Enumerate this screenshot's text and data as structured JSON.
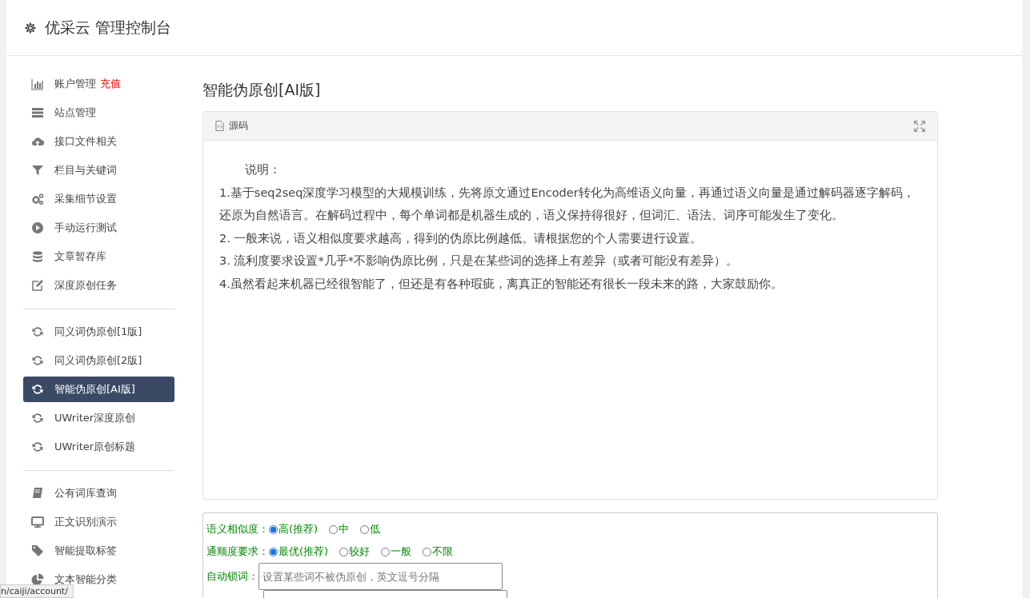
{
  "header": {
    "title": "优采云 管理控制台"
  },
  "sidebar": {
    "groups": [
      {
        "items": [
          {
            "label": "账户管理",
            "extra": "充值",
            "selected": false
          },
          {
            "label": "站点管理",
            "selected": false
          },
          {
            "label": "接口文件相关",
            "selected": false
          },
          {
            "label": "栏目与关键词",
            "selected": false
          },
          {
            "label": "采集细节设置",
            "selected": false
          },
          {
            "label": "手动运行测试",
            "selected": false
          },
          {
            "label": "文章暂存库",
            "selected": false
          },
          {
            "label": "深度原创任务",
            "selected": false
          }
        ]
      },
      {
        "items": [
          {
            "label": "同义词伪原创[1版]",
            "selected": false
          },
          {
            "label": "同义词伪原创[2版]",
            "selected": false
          },
          {
            "label": "智能伪原创[AI版]",
            "selected": true
          },
          {
            "label": "UWriter深度原创",
            "selected": false
          },
          {
            "label": "UWriter原创标题",
            "selected": false
          }
        ]
      },
      {
        "items": [
          {
            "label": "公有词库查询",
            "selected": false
          },
          {
            "label": "正文识别演示",
            "selected": false
          },
          {
            "label": "智能提取标签",
            "selected": false
          },
          {
            "label": "文本智能分类",
            "selected": false
          }
        ]
      }
    ]
  },
  "content": {
    "title": "智能伪原创[AI版]",
    "editor": {
      "tab": "源码",
      "lines": [
        {
          "kind": "heading",
          "text": "说明："
        },
        {
          "kind": "para",
          "text": "1.基于seq2seq深度学习模型的大规模训练，先将原文通过Encoder转化为高维语义向量，再通过语义向量是通过解码器逐字解码，还原为自然语言。在解码过程中，每个单词都是机器生成的，语义保持得很好，但词汇、语法、词序可能发生了变化。"
        },
        {
          "kind": "para",
          "text": "2. 一般来说，语义相似度要求越高，得到的伪原比例越低。请根据您的个人需要进行设置。"
        },
        {
          "kind": "para",
          "text": "3. 流利度要求设置*几乎*不影响伪原比例，只是在某些词的选择上有差异（或者可能没有差异）。"
        },
        {
          "kind": "para",
          "text": "4.虽然看起来机器已经很智能了，但还是有各种瑕疵，离真正的智能还有很长一段未来的路，大家鼓励你。"
        }
      ]
    },
    "form": {
      "rows": [
        {
          "kind": "radios",
          "label": "语义相似度：",
          "options": [
            {
              "label": "高(推荐)",
              "selected": true
            },
            {
              "label": "中",
              "selected": false
            },
            {
              "label": "低",
              "selected": false
            }
          ]
        },
        {
          "kind": "radios",
          "label": "通顺度要求：",
          "options": [
            {
              "label": "最优(推荐)",
              "selected": true
            },
            {
              "label": "较好",
              "selected": false
            },
            {
              "label": "一般",
              "selected": false
            },
            {
              "label": "不限",
              "selected": false
            }
          ]
        },
        {
          "kind": "input",
          "label": "自动锁词：",
          "placeholder": "设置某些词不被伪原创，英文逗号分隔"
        },
        {
          "kind": "input"
        }
      ]
    }
  },
  "status_bar": {
    "url": "n/caiji/account/"
  }
}
